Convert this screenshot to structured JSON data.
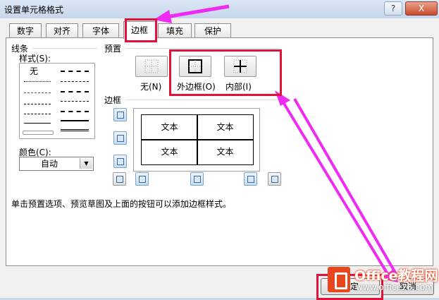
{
  "window": {
    "title": "设置单元格格式",
    "help_btn": "?",
    "close_btn": "X"
  },
  "tabs": [
    {
      "label": "数字"
    },
    {
      "label": "对齐"
    },
    {
      "label": "字体"
    },
    {
      "label": "边框",
      "active": true
    },
    {
      "label": "填充"
    },
    {
      "label": "保护"
    }
  ],
  "line_section": {
    "group_label": "线条",
    "style_label": "样式(S):",
    "none_label": "无",
    "color_label": "颜色(C):",
    "color_value": "自动"
  },
  "presets": {
    "group_label": "预置",
    "none": "无(N)",
    "outline": "外边框(O)",
    "inside": "内部(I)"
  },
  "border": {
    "group_label": "边框",
    "cells": [
      "文本",
      "文本",
      "文本",
      "文本"
    ]
  },
  "hint_text": "单击预置选项、预览草图及上面的按钮可以添加边框样式。",
  "buttons": {
    "ok": "确定",
    "cancel": "取消"
  },
  "watermark": {
    "name": "Office教程网",
    "url": "www.office26.com"
  },
  "colors": {
    "annotation": "#e0123a",
    "arrow": "#ee2bf0",
    "accent": "#3b6aa0"
  }
}
